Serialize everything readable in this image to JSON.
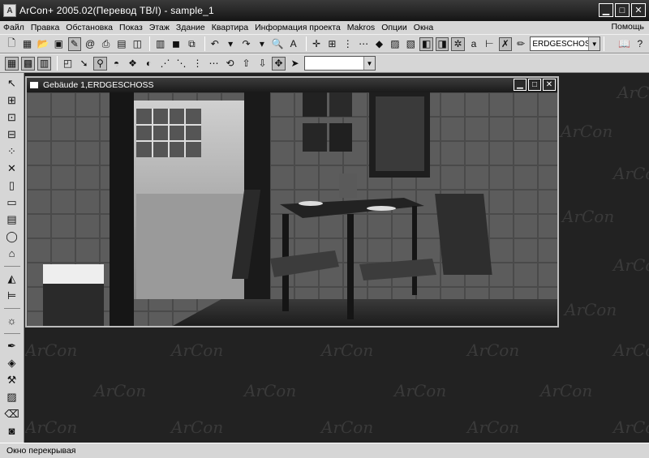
{
  "window": {
    "title": "ArCon+ 2005.02(Перевод ТВ/I) - sample_1",
    "app_icon": "arcon-logo-icon"
  },
  "menu": {
    "items": [
      "Файл",
      "Правка",
      "Обстановка",
      "Показ",
      "Этаж",
      "Здание",
      "Квартира",
      "Информация проекта",
      "Makros",
      "Опции",
      "Окна"
    ],
    "help": "Помощь"
  },
  "toolbar": {
    "floor_combo_value": "ERDGESCHOSS",
    "view_combo_value": ""
  },
  "subwindow": {
    "title": "Gebäude 1,ERDGESCHOSS"
  },
  "watermark": "ArCon",
  "statusbar": {
    "text": "Окно перекрывая"
  },
  "colors": {
    "title_bg": "#1a1a1a",
    "chrome": "#d6d6d6",
    "workspace": "#222222"
  }
}
